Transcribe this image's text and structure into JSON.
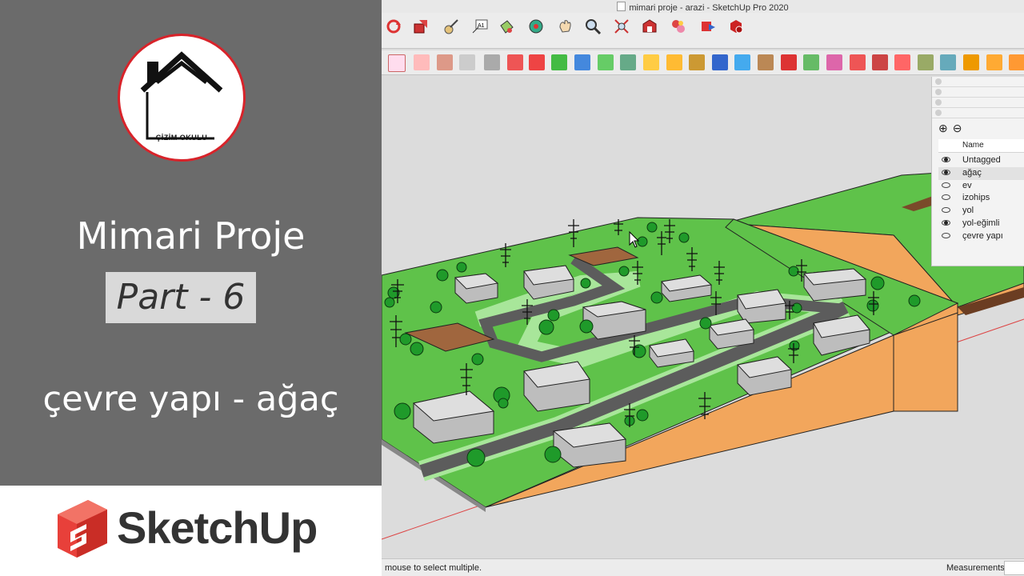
{
  "left_panel": {
    "logo_text": "ÇİZİM OKULU",
    "title": "Mimari Proje",
    "part": "Part - 6",
    "subtitle": "çevre yapı - ağaç",
    "brand": "SketchUp",
    "brand_color": "#e8403a"
  },
  "window": {
    "title": "mimari proje - arazi - SketchUp Pro 2020"
  },
  "tags_panel": {
    "column_header": "Name",
    "tags": [
      {
        "name": "Untagged",
        "visible": true
      },
      {
        "name": "ağaç",
        "visible": true,
        "selected": true
      },
      {
        "name": "ev",
        "visible": false
      },
      {
        "name": "izohips",
        "visible": false
      },
      {
        "name": "yol",
        "visible": false
      },
      {
        "name": "yol-eğimli",
        "visible": true
      },
      {
        "name": "çevre yapı",
        "visible": false
      }
    ]
  },
  "statusbar": {
    "hint": "mouse to select multiple.",
    "measurements_label": "Measurements"
  },
  "colors": {
    "grass": "#5fc24a",
    "terrain_side": "#f2a65c",
    "road": "#5c5c5c",
    "building": "#b9b9b9",
    "panel_gray": "#6b6b6b",
    "accent_red": "#d8232a"
  }
}
